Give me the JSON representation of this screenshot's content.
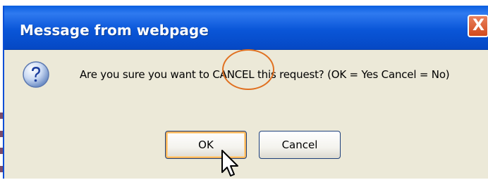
{
  "dialog": {
    "title": "Message from webpage",
    "close_glyph": "X",
    "message_before": "Are you sure you want to ",
    "message_highlight": "CANCEL",
    "message_after": " this request? (OK = Yes   Cancel = No)",
    "icon": "question-icon",
    "buttons": {
      "ok_label": "OK",
      "cancel_label": "Cancel"
    }
  },
  "colors": {
    "titlebar": "#0a56d8",
    "dialog_bg": "#ece9d8",
    "close_button": "#d24a1c",
    "annotation_circle": "#e07020"
  }
}
